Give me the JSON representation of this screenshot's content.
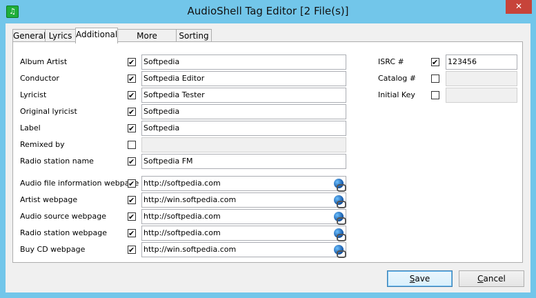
{
  "window": {
    "title": "AudioShell Tag Editor [2 File(s)]",
    "close": "✕"
  },
  "tabs": [
    {
      "label": "General"
    },
    {
      "label": "Lyrics"
    },
    {
      "label": "Additional"
    },
    {
      "label": "More Additional"
    },
    {
      "label": "Sorting"
    }
  ],
  "fields": {
    "album_artist": {
      "label": "Album Artist",
      "value": "Softpedia"
    },
    "conductor": {
      "label": "Conductor",
      "value": "Softpedia Editor"
    },
    "lyricist": {
      "label": "Lyricist",
      "value": "Softpedia Tester"
    },
    "original_lyricist": {
      "label": "Original lyricist",
      "value": "Softpedia"
    },
    "label": {
      "label": "Label",
      "value": "Softpedia"
    },
    "remixed_by": {
      "label": "Remixed by",
      "value": ""
    },
    "radio_station_name": {
      "label": "Radio station name",
      "value": "Softpedia FM"
    },
    "audio_file_webpage": {
      "label": "Audio file information webpage",
      "value": "http://softpedia.com"
    },
    "artist_webpage": {
      "label": "Artist webpage",
      "value": "http://win.softpedia.com"
    },
    "audio_source_webpage": {
      "label": "Audio source webpage",
      "value": "http://softpedia.com"
    },
    "radio_station_webpage": {
      "label": "Radio station webpage",
      "value": "http://softpedia.com"
    },
    "buy_cd_webpage": {
      "label": "Buy CD webpage",
      "value": "http://win.softpedia.com"
    },
    "isrc": {
      "label": "ISRC #",
      "value": "123456"
    },
    "catalog": {
      "label": "Catalog #",
      "value": ""
    },
    "initial_key": {
      "label": "Initial Key",
      "value": ""
    }
  },
  "buttons": {
    "save": {
      "pre": "",
      "accel": "S",
      "post": "ave"
    },
    "cancel": {
      "pre": "",
      "accel": "C",
      "post": "ancel"
    }
  }
}
